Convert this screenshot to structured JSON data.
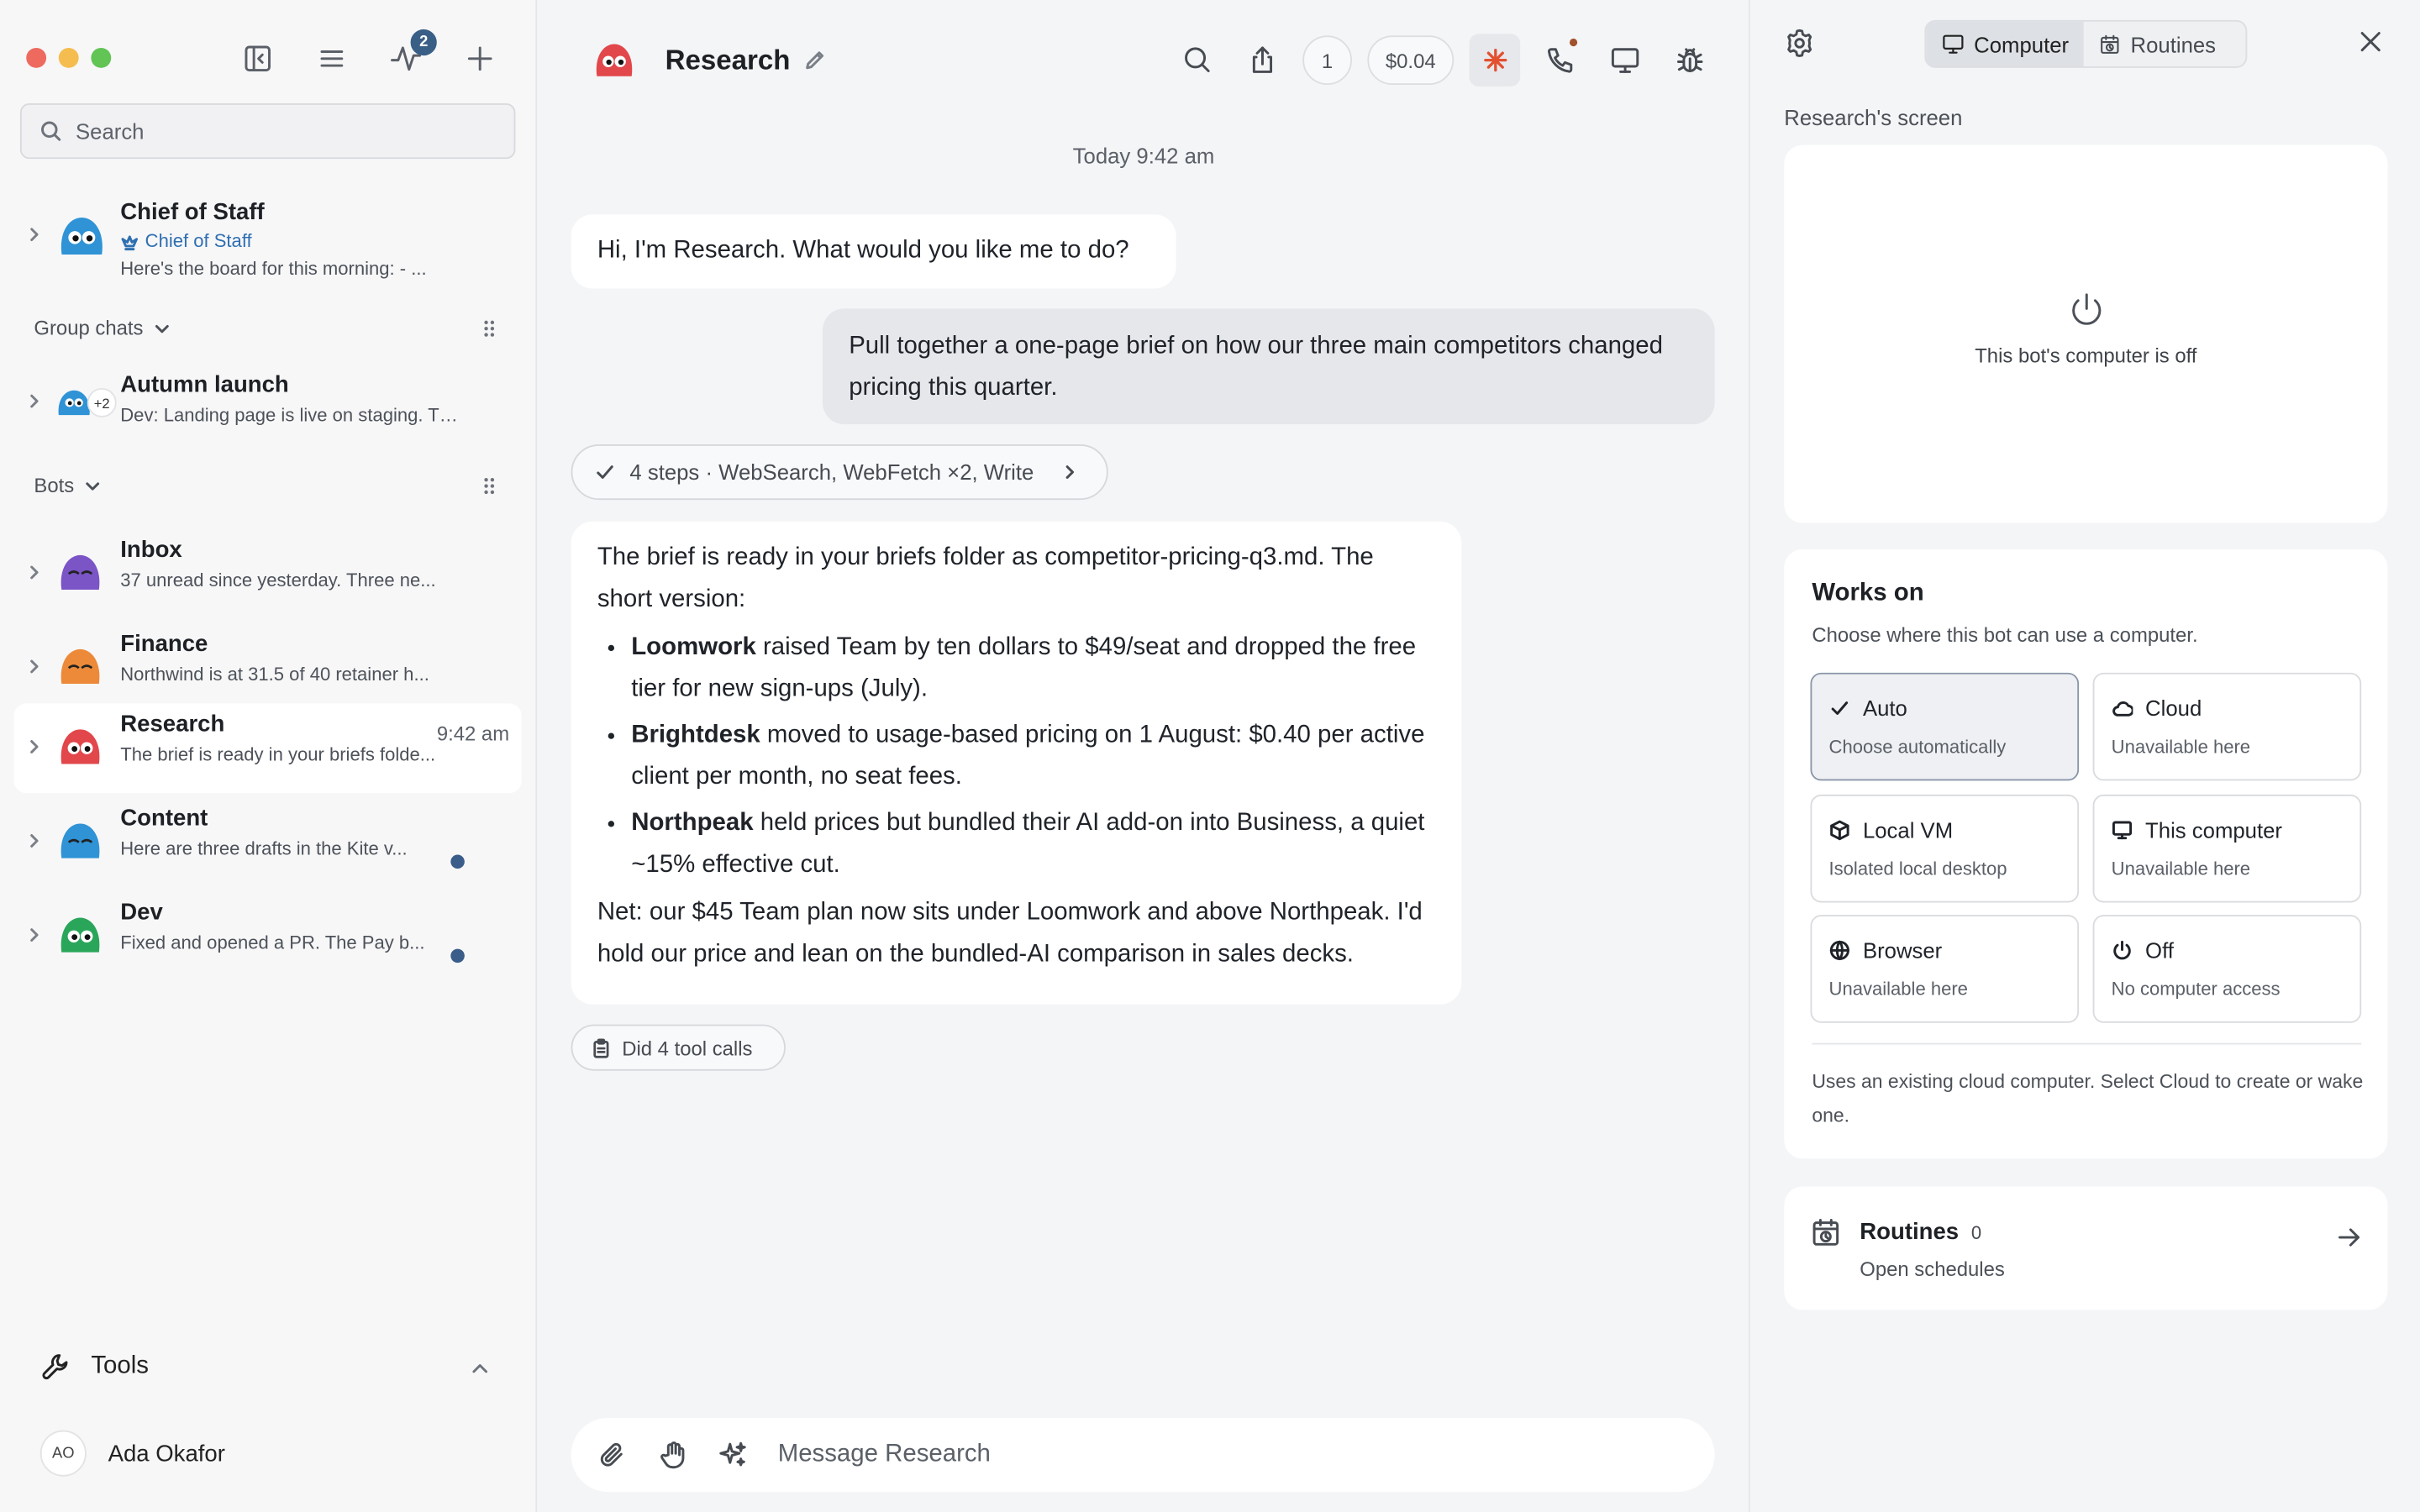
{
  "sidebar": {
    "activity_badge": "2",
    "search_placeholder": "Search",
    "chief": {
      "name": "Chief of Staff",
      "role": "Chief of Staff",
      "preview": "Here's the board for this morning: - ..."
    },
    "group_chats_label": "Group chats",
    "group": {
      "name": "Autumn launch",
      "extra": "+2",
      "preview": "Dev: Landing page is live on staging. The ..."
    },
    "bots_label": "Bots",
    "bots": [
      {
        "name": "Inbox",
        "preview": "37 unread since yesterday. Three ne...",
        "time": "",
        "color": "#7b54c6"
      },
      {
        "name": "Finance",
        "preview": "Northwind is at 31.5 of 40 retainer h...",
        "time": "",
        "color": "#ec8a3a"
      },
      {
        "name": "Research",
        "preview": "The brief is ready in your briefs folde...",
        "time": "9:42 am",
        "color": "#e2474b"
      },
      {
        "name": "Content",
        "preview": "Here are three drafts in the Kite v...",
        "time": "",
        "color": "#2f93d6"
      },
      {
        "name": "Dev",
        "preview": "Fixed and opened a PR. The Pay b...",
        "time": "",
        "color": "#2aa65a"
      }
    ],
    "tools_label": "Tools",
    "user": {
      "initials": "AO",
      "name": "Ada Okafor"
    }
  },
  "main": {
    "title": "Research",
    "count_pill": "1",
    "cost_pill": "$0.04",
    "timestamp": "Today 9:42 am",
    "greeting": "Hi, I'm Research. What would you like me to do?",
    "user_message": "Pull together a one-page brief on how our three main competitors changed pricing this quarter.",
    "steps_label": "4 steps · WebSearch, WebFetch ×2, Write",
    "reply": {
      "intro": "The brief is ready in your briefs folder as competitor-pricing-q3.md. The short version:",
      "items": [
        {
          "bold": "Loomwork",
          "text": " raised Team by ten dollars to $49/seat and dropped the free tier for new sign-ups (July)."
        },
        {
          "bold": "Brightdesk",
          "text": " moved to usage-based pricing on 1 August: $0.40 per active client per month, no seat fees."
        },
        {
          "bold": "Northpeak",
          "text": " held prices but bundled their AI add-on into Business, a quiet ~15% effective cut."
        }
      ],
      "net": "Net: our $45 Team plan now sits under Loomwork and above Northpeak. I'd hold our price and lean on the bundled-AI comparison in sales decks."
    },
    "tool_calls_label": "Did 4 tool calls",
    "composer_placeholder": "Message Research"
  },
  "panel": {
    "tab_computer": "Computer",
    "tab_routines": "Routines",
    "screen_label": "Research's screen",
    "screen_off": "This bot's computer is off",
    "works_title": "Works on",
    "works_sub": "Choose where this bot can use a computer.",
    "options": [
      {
        "title": "Auto",
        "desc": "Choose automatically",
        "icon": "check-icon"
      },
      {
        "title": "Cloud",
        "desc": "Unavailable here",
        "icon": "cloud-icon"
      },
      {
        "title": "Local VM",
        "desc": "Isolated local desktop",
        "icon": "cube-icon"
      },
      {
        "title": "This computer",
        "desc": "Unavailable here",
        "icon": "monitor-icon"
      },
      {
        "title": "Browser",
        "desc": "Unavailable here",
        "icon": "globe-icon"
      },
      {
        "title": "Off",
        "desc": "No computer access",
        "icon": "power-icon"
      }
    ],
    "works_note": "Uses an existing cloud computer. Select Cloud to create or wake one.",
    "routines_title": "Routines",
    "routines_count": "0",
    "routines_sub": "Open schedules"
  }
}
